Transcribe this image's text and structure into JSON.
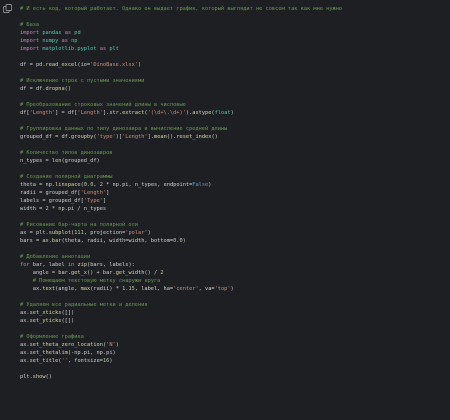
{
  "icons": {
    "copy": "copy-icon"
  },
  "colors": {
    "background": "#1e1f22",
    "comment": "#6a9955",
    "keyword": "#c586c0",
    "module": "#4ec9b0",
    "function": "#dcdcaa",
    "string": "#ce9178",
    "number": "#b5cea8",
    "text": "#d4d4d4"
  },
  "lines": [
    {
      "type": "code",
      "tokens": [
        [
          "cm",
          "# И есть код, который работает. Однако он выдает график, который выглядит не совсем так как мне нужно"
        ]
      ]
    },
    {
      "type": "blank"
    },
    {
      "type": "code",
      "tokens": [
        [
          "cm",
          "# База"
        ]
      ]
    },
    {
      "type": "code",
      "tokens": [
        [
          "kw",
          "import"
        ],
        [
          "id",
          " "
        ],
        [
          "mod",
          "pandas"
        ],
        [
          "id",
          " "
        ],
        [
          "kw",
          "as"
        ],
        [
          "id",
          " "
        ],
        [
          "mod",
          "pd"
        ]
      ]
    },
    {
      "type": "code",
      "tokens": [
        [
          "kw",
          "import"
        ],
        [
          "id",
          " "
        ],
        [
          "mod",
          "numpy"
        ],
        [
          "id",
          " "
        ],
        [
          "kw",
          "as"
        ],
        [
          "id",
          " "
        ],
        [
          "mod",
          "np"
        ]
      ]
    },
    {
      "type": "code",
      "tokens": [
        [
          "kw",
          "import"
        ],
        [
          "id",
          " "
        ],
        [
          "mod",
          "matplotlib.pyplot"
        ],
        [
          "id",
          " "
        ],
        [
          "kw",
          "as"
        ],
        [
          "id",
          " "
        ],
        [
          "mod",
          "plt"
        ]
      ]
    },
    {
      "type": "blank"
    },
    {
      "type": "code",
      "tokens": [
        [
          "id",
          "df = pd."
        ],
        [
          "fn",
          "read_excel"
        ],
        [
          "id",
          "(io="
        ],
        [
          "str",
          "'DinoBase.xlsx'"
        ],
        [
          "id",
          ")"
        ]
      ]
    },
    {
      "type": "blank"
    },
    {
      "type": "code",
      "tokens": [
        [
          "cm",
          "# Исключение строк с пустыми значениями"
        ]
      ]
    },
    {
      "type": "code",
      "tokens": [
        [
          "id",
          "df = df."
        ],
        [
          "fn",
          "dropna"
        ],
        [
          "id",
          "()"
        ]
      ]
    },
    {
      "type": "blank"
    },
    {
      "type": "code",
      "tokens": [
        [
          "cm",
          "# Преобразование строковых значений длины в числовые"
        ]
      ]
    },
    {
      "type": "code",
      "tokens": [
        [
          "id",
          "df["
        ],
        [
          "str",
          "'Length'"
        ],
        [
          "id",
          "] = df["
        ],
        [
          "str",
          "'Length'"
        ],
        [
          "id",
          "].str."
        ],
        [
          "fn",
          "extract"
        ],
        [
          "id",
          "("
        ],
        [
          "str",
          "'(\\d+\\.\\d+)'"
        ],
        [
          "id",
          ")."
        ],
        [
          "fn",
          "astype"
        ],
        [
          "id",
          "("
        ],
        [
          "mod",
          "float"
        ],
        [
          "id",
          ")"
        ]
      ]
    },
    {
      "type": "blank"
    },
    {
      "type": "code",
      "tokens": [
        [
          "cm",
          "# Группировка данных по типу динозавра и вычисление средней длины"
        ]
      ]
    },
    {
      "type": "code",
      "tokens": [
        [
          "id",
          "grouped_df = df."
        ],
        [
          "fn",
          "groupby"
        ],
        [
          "id",
          "("
        ],
        [
          "str",
          "'type'"
        ],
        [
          "id",
          ")["
        ],
        [
          "str",
          "'Length'"
        ],
        [
          "id",
          "]."
        ],
        [
          "fn",
          "mean"
        ],
        [
          "id",
          "()."
        ],
        [
          "fn",
          "reset_index"
        ],
        [
          "id",
          "()"
        ]
      ]
    },
    {
      "type": "blank"
    },
    {
      "type": "code",
      "tokens": [
        [
          "cm",
          "# Количество типов динозавров"
        ]
      ]
    },
    {
      "type": "code",
      "tokens": [
        [
          "id",
          "n_types = "
        ],
        [
          "fn",
          "len"
        ],
        [
          "id",
          "(grouped_df)"
        ]
      ]
    },
    {
      "type": "blank"
    },
    {
      "type": "code",
      "tokens": [
        [
          "cm",
          "# Создание полярной диаграммы"
        ]
      ]
    },
    {
      "type": "code",
      "tokens": [
        [
          "id",
          "theta = np."
        ],
        [
          "fn",
          "linspace"
        ],
        [
          "id",
          "("
        ],
        [
          "num",
          "0.0"
        ],
        [
          "id",
          ", "
        ],
        [
          "num",
          "2"
        ],
        [
          "id",
          " * np.pi, n_types, endpoint="
        ],
        [
          "bool",
          "False"
        ],
        [
          "id",
          ")"
        ]
      ]
    },
    {
      "type": "code",
      "tokens": [
        [
          "id",
          "radii = grouped_df["
        ],
        [
          "str",
          "'Length'"
        ],
        [
          "id",
          "]"
        ]
      ]
    },
    {
      "type": "code",
      "tokens": [
        [
          "id",
          "labels = grouped_df["
        ],
        [
          "str",
          "'Type'"
        ],
        [
          "id",
          "]"
        ]
      ]
    },
    {
      "type": "code",
      "tokens": [
        [
          "id",
          "width = "
        ],
        [
          "num",
          "2"
        ],
        [
          "id",
          " * np.pi / n_types"
        ]
      ]
    },
    {
      "type": "blank"
    },
    {
      "type": "code",
      "tokens": [
        [
          "cm",
          "# Рисование бар-чарта на полярной оси"
        ]
      ]
    },
    {
      "type": "code",
      "tokens": [
        [
          "id",
          "ax = plt."
        ],
        [
          "fn",
          "subplot"
        ],
        [
          "id",
          "("
        ],
        [
          "num",
          "111"
        ],
        [
          "id",
          ", projection="
        ],
        [
          "str",
          "'polar'"
        ],
        [
          "id",
          ")"
        ]
      ]
    },
    {
      "type": "code",
      "tokens": [
        [
          "id",
          "bars = ax."
        ],
        [
          "fn",
          "bar"
        ],
        [
          "id",
          "(theta, radii, width=width, bottom="
        ],
        [
          "num",
          "0.0"
        ],
        [
          "id",
          ")"
        ]
      ]
    },
    {
      "type": "blank"
    },
    {
      "type": "code",
      "tokens": [
        [
          "cm",
          "# Добавление аннотации"
        ]
      ]
    },
    {
      "type": "code",
      "tokens": [
        [
          "kw",
          "for"
        ],
        [
          "id",
          " bar, label "
        ],
        [
          "kw",
          "in"
        ],
        [
          "id",
          " "
        ],
        [
          "fn",
          "zip"
        ],
        [
          "id",
          "(bars, labels):"
        ]
      ]
    },
    {
      "type": "code",
      "tokens": [
        [
          "id",
          "    angle = bar."
        ],
        [
          "fn",
          "get_x"
        ],
        [
          "id",
          "() + bar."
        ],
        [
          "fn",
          "get_width"
        ],
        [
          "id",
          "() / "
        ],
        [
          "num",
          "2"
        ]
      ]
    },
    {
      "type": "code",
      "tokens": [
        [
          "cm",
          "    # Помещаем текстовую метку снаружи круга"
        ]
      ]
    },
    {
      "type": "code",
      "tokens": [
        [
          "id",
          "    ax."
        ],
        [
          "fn",
          "text"
        ],
        [
          "id",
          "(angle, "
        ],
        [
          "fn",
          "max"
        ],
        [
          "id",
          "(radii) * "
        ],
        [
          "num",
          "1.15"
        ],
        [
          "id",
          ", label, ha="
        ],
        [
          "str",
          "'center'"
        ],
        [
          "id",
          ", va="
        ],
        [
          "str",
          "'top'"
        ],
        [
          "id",
          ")"
        ]
      ]
    },
    {
      "type": "blank"
    },
    {
      "type": "code",
      "tokens": [
        [
          "cm",
          "# Удаляем все радиальные метки и деления"
        ]
      ]
    },
    {
      "type": "code",
      "tokens": [
        [
          "id",
          "ax."
        ],
        [
          "fn",
          "set_xticks"
        ],
        [
          "id",
          "([])"
        ]
      ]
    },
    {
      "type": "code",
      "tokens": [
        [
          "id",
          "ax."
        ],
        [
          "fn",
          "set_yticks"
        ],
        [
          "id",
          "([])"
        ]
      ]
    },
    {
      "type": "blank"
    },
    {
      "type": "code",
      "tokens": [
        [
          "cm",
          "# Оформление графика"
        ]
      ]
    },
    {
      "type": "code",
      "tokens": [
        [
          "id",
          "ax."
        ],
        [
          "fn",
          "set_theta_zero_location"
        ],
        [
          "id",
          "("
        ],
        [
          "str",
          "'N'"
        ],
        [
          "id",
          ")"
        ]
      ]
    },
    {
      "type": "code",
      "tokens": [
        [
          "id",
          "ax."
        ],
        [
          "fn",
          "set_thetalim"
        ],
        [
          "id",
          "(-np.pi, np.pi)"
        ]
      ]
    },
    {
      "type": "code",
      "tokens": [
        [
          "id",
          "ax."
        ],
        [
          "fn",
          "set_title"
        ],
        [
          "id",
          "("
        ],
        [
          "str",
          "''"
        ],
        [
          "id",
          ", fontsize="
        ],
        [
          "num",
          "16"
        ],
        [
          "id",
          ")"
        ]
      ]
    },
    {
      "type": "blank"
    },
    {
      "type": "code",
      "tokens": [
        [
          "id",
          "plt."
        ],
        [
          "fn",
          "show"
        ],
        [
          "id",
          "()"
        ]
      ]
    }
  ]
}
